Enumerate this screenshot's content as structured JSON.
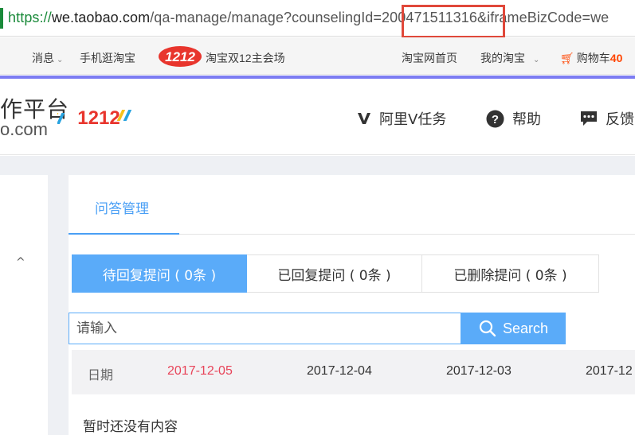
{
  "browser": {
    "url_scheme": "https://",
    "url_host": "we.taobao.com",
    "url_path": "/qa-manage/manage?counselingId=",
    "url_id": "200471511316",
    "url_tail": "&iframeBizCode=we"
  },
  "topnav": {
    "messages": "消息",
    "mobile": "手机逛淘宝",
    "logo_text": "1212",
    "promo": "淘宝双12主会场",
    "home": "淘宝网首页",
    "my_taobao": "我的淘宝",
    "cart_label": "购物车",
    "cart_count": "40"
  },
  "header": {
    "brand_top": "作平台",
    "brand_bottom": "o.com",
    "logo_text": "1212",
    "nav": [
      {
        "label": "阿里V任务"
      },
      {
        "label": "帮助"
      },
      {
        "label": "反馈"
      }
    ]
  },
  "tabs": {
    "active": "问答管理"
  },
  "filters": [
    {
      "label": "待回复提问 ( 0条 )"
    },
    {
      "label": "已回复提问 ( 0条 )"
    },
    {
      "label": "已删除提问 ( 0条 )"
    }
  ],
  "search": {
    "placeholder": "请输入",
    "button": "Search"
  },
  "dates": {
    "label": "日期",
    "items": [
      "2017-12-05",
      "2017-12-04",
      "2017-12-03",
      "2017-12"
    ]
  },
  "empty_text": "暂时还没有内容",
  "colors": {
    "accent": "#5aabf9",
    "highlight": "#e0483a",
    "active_date": "#e8455a",
    "cart": "#ff4400"
  }
}
